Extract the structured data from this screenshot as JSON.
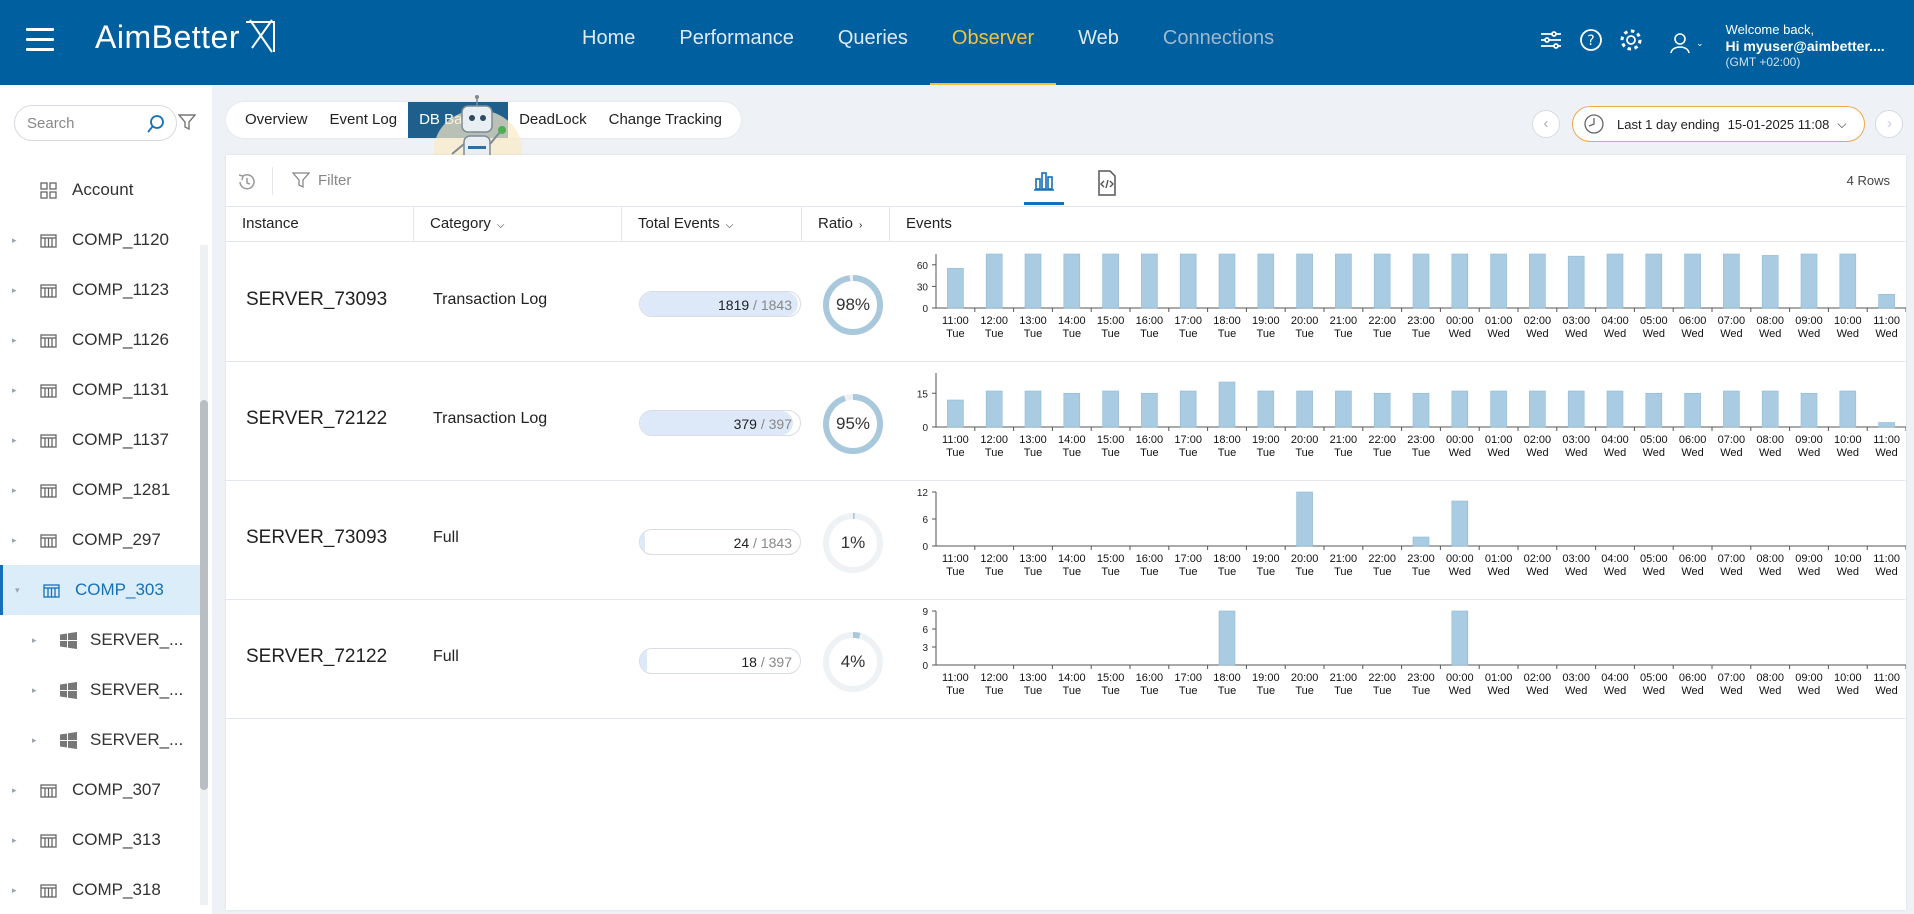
{
  "app": {
    "logo_text": "AimBetter",
    "nav": [
      "Home",
      "Performance",
      "Queries",
      "Observer",
      "Web",
      "Connections"
    ],
    "nav_active": 3,
    "user": {
      "welcome": "Welcome back,",
      "name": "Hi myuser@aimbetter....",
      "tz": "(GMT +02:00)"
    }
  },
  "sidebar": {
    "search_placeholder": "Search",
    "items": [
      {
        "label": "Account",
        "type": "account",
        "level": 0
      },
      {
        "label": "COMP_1120",
        "type": "comp",
        "level": 0
      },
      {
        "label": "COMP_1123",
        "type": "comp",
        "level": 0
      },
      {
        "label": "COMP_1126",
        "type": "comp",
        "level": 0
      },
      {
        "label": "COMP_1131",
        "type": "comp",
        "level": 0
      },
      {
        "label": "COMP_1137",
        "type": "comp",
        "level": 0
      },
      {
        "label": "COMP_1281",
        "type": "comp",
        "level": 0
      },
      {
        "label": "COMP_297",
        "type": "comp",
        "level": 0
      },
      {
        "label": "COMP_303",
        "type": "comp",
        "level": 0,
        "selected": true,
        "expanded": true
      },
      {
        "label": "SERVER_...",
        "type": "server",
        "level": 1
      },
      {
        "label": "SERVER_...",
        "type": "server",
        "level": 1
      },
      {
        "label": "SERVER_...",
        "type": "server",
        "level": 1
      },
      {
        "label": "COMP_307",
        "type": "comp",
        "level": 0
      },
      {
        "label": "COMP_313",
        "type": "comp",
        "level": 0
      },
      {
        "label": "COMP_318",
        "type": "comp",
        "level": 0
      }
    ]
  },
  "subtabs": [
    "Overview",
    "Event Log",
    "DB Ba",
    "DeadLock",
    "Change Tracking"
  ],
  "subtab_active": 2,
  "time_range": {
    "label": "Last 1 day ending",
    "value": "15-01-2025 11:08"
  },
  "toolbar": {
    "filter_placeholder": "Filter",
    "rows": "4 Rows"
  },
  "table": {
    "headers": [
      "Instance",
      "Category",
      "Total Events",
      "Ratio",
      "Events"
    ],
    "rows": [
      {
        "instance": "SERVER_73093",
        "category": "Transaction Log",
        "count": "1819",
        "total": "1843",
        "ratio": 98,
        "ratio_label": "98%"
      },
      {
        "instance": "SERVER_72122",
        "category": "Transaction Log",
        "count": "379",
        "total": "397",
        "ratio": 95,
        "ratio_label": "95%"
      },
      {
        "instance": "SERVER_73093",
        "category": "Full",
        "count": "24",
        "total": "1843",
        "ratio": 1,
        "ratio_label": "1%"
      },
      {
        "instance": "SERVER_72122",
        "category": "Full",
        "count": "18",
        "total": "397",
        "ratio": 4,
        "ratio_label": "4%"
      }
    ]
  },
  "chart_data": [
    {
      "type": "bar",
      "categories": [
        "11:00 Tue",
        "12:00 Tue",
        "13:00 Tue",
        "14:00 Tue",
        "15:00 Tue",
        "16:00 Tue",
        "17:00 Tue",
        "18:00 Tue",
        "19:00 Tue",
        "20:00 Tue",
        "21:00 Tue",
        "22:00 Tue",
        "23:00 Tue",
        "00:00 Wed",
        "01:00 Wed",
        "02:00 Wed",
        "03:00 Wed",
        "04:00 Wed",
        "05:00 Wed",
        "06:00 Wed",
        "07:00 Wed",
        "08:00 Wed",
        "09:00 Wed",
        "10:00 Wed",
        "11:00 Wed"
      ],
      "values": [
        55,
        75,
        75,
        75,
        75,
        75,
        75,
        75,
        75,
        75,
        75,
        75,
        75,
        75,
        75,
        75,
        72,
        75,
        75,
        75,
        75,
        73,
        75,
        75,
        19
      ],
      "yticks": [
        0,
        30,
        60
      ],
      "ylim": [
        0,
        75
      ]
    },
    {
      "type": "bar",
      "categories": [
        "11:00 Tue",
        "12:00 Tue",
        "13:00 Tue",
        "14:00 Tue",
        "15:00 Tue",
        "16:00 Tue",
        "17:00 Tue",
        "18:00 Tue",
        "19:00 Tue",
        "20:00 Tue",
        "21:00 Tue",
        "22:00 Tue",
        "23:00 Tue",
        "00:00 Wed",
        "01:00 Wed",
        "02:00 Wed",
        "03:00 Wed",
        "04:00 Wed",
        "05:00 Wed",
        "06:00 Wed",
        "07:00 Wed",
        "08:00 Wed",
        "09:00 Wed",
        "10:00 Wed",
        "11:00 Wed"
      ],
      "values": [
        12,
        16,
        16,
        15,
        16,
        15,
        16,
        20,
        16,
        16,
        16,
        15,
        15,
        16,
        16,
        16,
        16,
        16,
        15,
        15,
        16,
        16,
        15,
        16,
        2
      ],
      "yticks": [
        0,
        15
      ],
      "ylim": [
        0,
        24
      ]
    },
    {
      "type": "bar",
      "categories": [
        "11:00 Tue",
        "12:00 Tue",
        "13:00 Tue",
        "14:00 Tue",
        "15:00 Tue",
        "16:00 Tue",
        "17:00 Tue",
        "18:00 Tue",
        "19:00 Tue",
        "20:00 Tue",
        "21:00 Tue",
        "22:00 Tue",
        "23:00 Tue",
        "00:00 Wed",
        "01:00 Wed",
        "02:00 Wed",
        "03:00 Wed",
        "04:00 Wed",
        "05:00 Wed",
        "06:00 Wed",
        "07:00 Wed",
        "08:00 Wed",
        "09:00 Wed",
        "10:00 Wed",
        "11:00 Wed"
      ],
      "values": [
        0,
        0,
        0,
        0,
        0,
        0,
        0,
        0,
        0,
        12,
        0,
        0,
        2,
        10,
        0,
        0,
        0,
        0,
        0,
        0,
        0,
        0,
        0,
        0,
        0
      ],
      "yticks": [
        0,
        6,
        12
      ],
      "ylim": [
        0,
        12
      ]
    },
    {
      "type": "bar",
      "categories": [
        "11:00 Tue",
        "12:00 Tue",
        "13:00 Tue",
        "14:00 Tue",
        "15:00 Tue",
        "16:00 Tue",
        "17:00 Tue",
        "18:00 Tue",
        "19:00 Tue",
        "20:00 Tue",
        "21:00 Tue",
        "22:00 Tue",
        "23:00 Tue",
        "00:00 Wed",
        "01:00 Wed",
        "02:00 Wed",
        "03:00 Wed",
        "04:00 Wed",
        "05:00 Wed",
        "06:00 Wed",
        "07:00 Wed",
        "08:00 Wed",
        "09:00 Wed",
        "10:00 Wed",
        "11:00 Wed"
      ],
      "values": [
        0,
        0,
        0,
        0,
        0,
        0,
        0,
        9,
        0,
        0,
        0,
        0,
        0,
        9,
        0,
        0,
        0,
        0,
        0,
        0,
        0,
        0,
        0,
        0,
        0
      ],
      "yticks": [
        0,
        3,
        6,
        9
      ],
      "ylim": [
        0,
        9
      ]
    }
  ],
  "colors": {
    "brand": "#005f9e",
    "active_nav": "#f3c13a",
    "bar": "#a9cce3",
    "bar_stroke": "#8fb9d6",
    "ring": "#a9c8dc",
    "ring_track": "#eef2f5"
  }
}
